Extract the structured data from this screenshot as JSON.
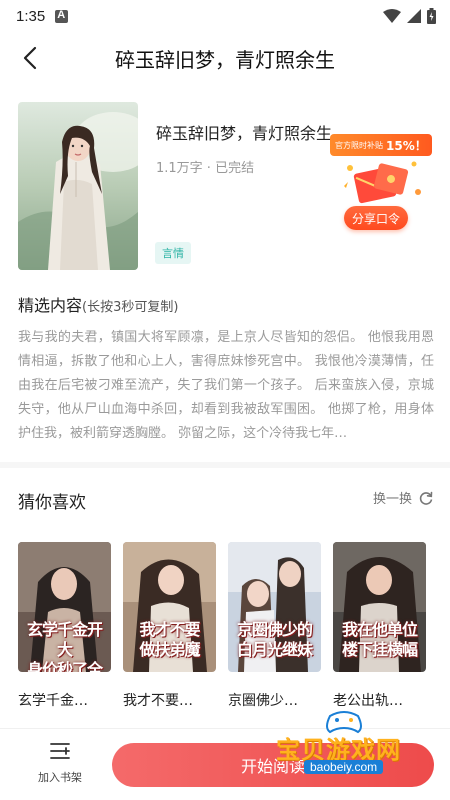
{
  "status": {
    "time": "1:35"
  },
  "header": {
    "title": "碎玉辞旧梦，青灯照余生"
  },
  "book": {
    "title": "碎玉辞旧梦，青灯照余生",
    "meta": "1.1万字 · 已完结",
    "tag": "言情"
  },
  "promo": {
    "badge_label": "官方限时补贴",
    "badge_percent": "15%！",
    "share_label": "分享口令"
  },
  "excerpt": {
    "title": "精选内容",
    "hint": "(长按3秒可复制)",
    "body": "我与我的夫君，镇国大将军顾凛，是上京人尽皆知的怨侣。 他恨我用恩情相逼，拆散了他和心上人，害得庶妹惨死宫中。 我恨他冷漠薄情，任由我在后宅被刁难至流产，失了我们第一个孩子。 后来蛮族入侵，京城失守，他从尸山血海中杀回，却看到我被敌军围困。 他掷了枪，用身体护住我，被利箭穿透胸膛。 弥留之际，这个冷待我七年…"
  },
  "recommend": {
    "title": "猜你喜欢",
    "refresh_label": "换一换",
    "items": [
      {
        "name": "玄学千金…",
        "cover_text": "玄学千金开大\n身价秒了全家"
      },
      {
        "name": "我才不要…",
        "cover_text": "我才不要\n做扶弟魔"
      },
      {
        "name": "京圈佛少…",
        "cover_text": "京圈佛少的\n白月光继妹"
      },
      {
        "name": "老公出轨…",
        "cover_text": "我在他单位\n楼下挂横幅"
      }
    ]
  },
  "bottom": {
    "shelf_label": "加入书架",
    "read_label": "开始阅读"
  },
  "watermark": {
    "text": "宝贝游戏网",
    "url": "baobeiy.com"
  },
  "colors": {
    "accent": "#ee4b4b",
    "tag": "#2bb3a4",
    "promo": "#ff5a1f"
  }
}
